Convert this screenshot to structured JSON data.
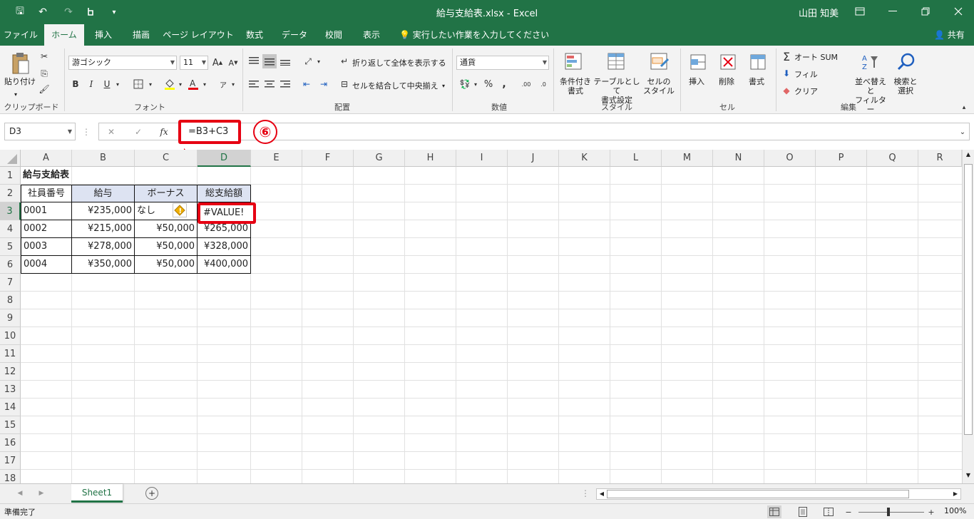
{
  "titlebar": {
    "title": "給与支給表.xlsx  -  Excel",
    "user": "山田 知美",
    "undo_glyph": "↶",
    "redo_glyph": "↷",
    "save_glyph": "🖫"
  },
  "tabs": [
    {
      "label": "ファイル",
      "active": false
    },
    {
      "label": "ホーム",
      "active": true
    },
    {
      "label": "挿入",
      "active": false
    },
    {
      "label": "描画",
      "active": false
    },
    {
      "label": "ページ レイアウト",
      "active": false
    },
    {
      "label": "数式",
      "active": false
    },
    {
      "label": "データ",
      "active": false
    },
    {
      "label": "校閲",
      "active": false
    },
    {
      "label": "表示",
      "active": false
    }
  ],
  "tell_me": "実行したい作業を入力してください",
  "share": "共有",
  "ribbon": {
    "clipboard": {
      "label": "クリップボード",
      "paste": "貼り付け"
    },
    "font": {
      "label": "フォント",
      "font_name": "游ゴシック",
      "font_size": "11",
      "bold": "B",
      "italic": "I",
      "underline": "U"
    },
    "alignment": {
      "label": "配置",
      "wrap": "折り返して全体を表示する",
      "merge": "セルを結合して中央揃え"
    },
    "number": {
      "label": "数値",
      "format": "通貨",
      "percent": "%",
      "comma": ","
    },
    "styles": {
      "label": "スタイル",
      "conditional": [
        "条件付き",
        "書式"
      ],
      "table": [
        "テーブルとして",
        "書式設定"
      ],
      "cell": [
        "セルの",
        "スタイル"
      ]
    },
    "cells": {
      "label": "セル",
      "insert": "挿入",
      "delete": "削除",
      "format": "書式"
    },
    "editing": {
      "label": "編集",
      "autosum": "オート SUM",
      "fill": "フィル",
      "clear": "クリア",
      "sort": [
        "並べ替えと",
        "フィルター"
      ],
      "find": [
        "検索と",
        "選択"
      ]
    }
  },
  "namebox": "D3",
  "formula": "=B3+C3",
  "step_marker": "⑥",
  "columns": [
    "A",
    "B",
    "C",
    "D",
    "E",
    "F",
    "G",
    "H",
    "I",
    "J",
    "K",
    "L",
    "M",
    "N",
    "O",
    "P",
    "Q",
    "R"
  ],
  "rows": [
    "1",
    "2",
    "3",
    "4",
    "5",
    "6",
    "7",
    "8",
    "9",
    "10",
    "11",
    "12",
    "13",
    "14",
    "15",
    "16",
    "17",
    "18"
  ],
  "sheet": {
    "title": "給与支給表",
    "headers": [
      "社員番号",
      "給与",
      "ボーナス",
      "総支給額"
    ],
    "data": [
      [
        "0001",
        "¥235,000",
        "なし",
        "#VALUE!"
      ],
      [
        "0002",
        "¥215,000",
        "¥50,000",
        "¥265,000"
      ],
      [
        "0003",
        "¥278,000",
        "¥50,000",
        "¥328,000"
      ],
      [
        "0004",
        "¥350,000",
        "¥50,000",
        "¥400,000"
      ]
    ]
  },
  "sheet_tab": "Sheet1",
  "status": "準備完了",
  "zoom": "100%",
  "colors": {
    "accent": "#217346",
    "highlight": "#e60012",
    "header_fill": "#dde3f2"
  }
}
